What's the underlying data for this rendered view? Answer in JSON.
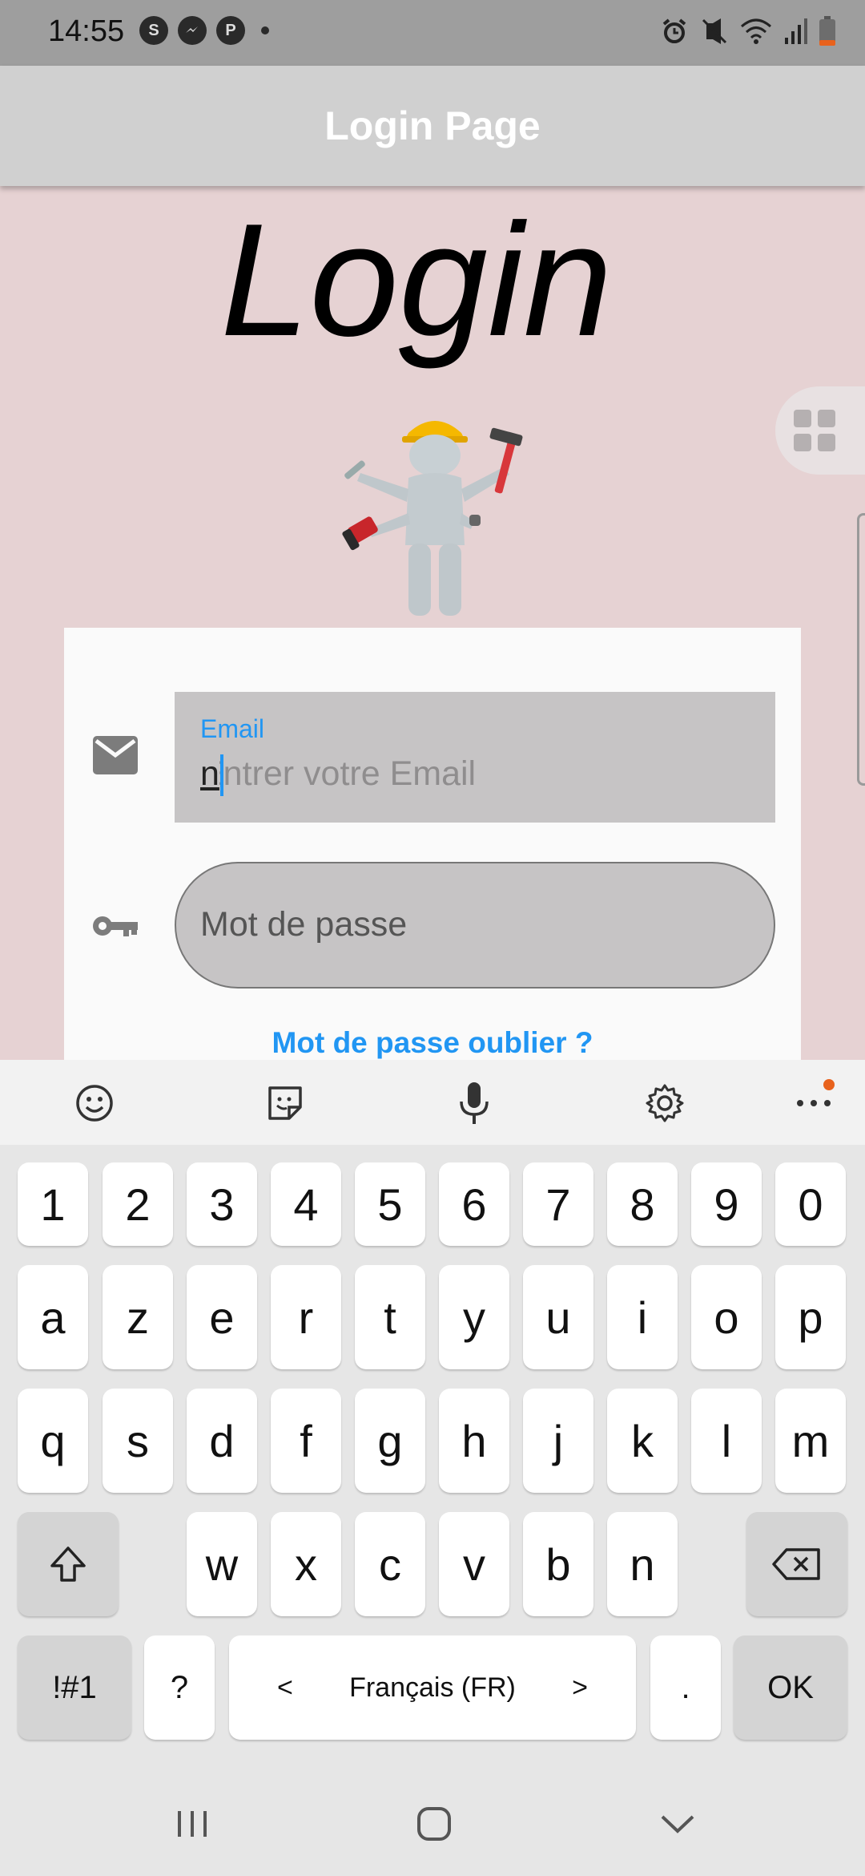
{
  "status_bar": {
    "time": "14:55",
    "left_icons": [
      "s-app-icon",
      "messenger-icon",
      "app-icon",
      "dot-icon"
    ],
    "right_icons": [
      "alarm-icon",
      "mute-icon",
      "wifi-icon",
      "signal-icon",
      "battery-icon"
    ]
  },
  "app_bar": {
    "title": "Login Page"
  },
  "main": {
    "heading": "Login",
    "email": {
      "label": "Email",
      "placeholder": "Entrer votre Email",
      "value": "n"
    },
    "password": {
      "placeholder": "Mot de passe"
    },
    "forgot_link": "Mot de passe oublier ?"
  },
  "keyboard": {
    "toolbar": [
      "emoji-icon",
      "sticker-icon",
      "microphone-icon",
      "settings-icon",
      "more-icon"
    ],
    "row_numbers": [
      "1",
      "2",
      "3",
      "4",
      "5",
      "6",
      "7",
      "8",
      "9",
      "0"
    ],
    "row1": [
      "a",
      "z",
      "e",
      "r",
      "t",
      "y",
      "u",
      "i",
      "o",
      "p"
    ],
    "row2": [
      "q",
      "s",
      "d",
      "f",
      "g",
      "h",
      "j",
      "k",
      "l",
      "m"
    ],
    "row3": [
      "w",
      "x",
      "c",
      "v",
      "b",
      "n"
    ],
    "symbols_label": "!#1",
    "question_label": "?",
    "space_label": "Français (FR)",
    "space_left": "<",
    "space_right": ">",
    "period_label": ".",
    "ok_label": "OK"
  },
  "colors": {
    "accent": "#2196f3",
    "background": "#e6d2d3",
    "app_bar": "#d0d0d0",
    "field": "#c6c4c5",
    "notification_dot": "#e8621d"
  }
}
